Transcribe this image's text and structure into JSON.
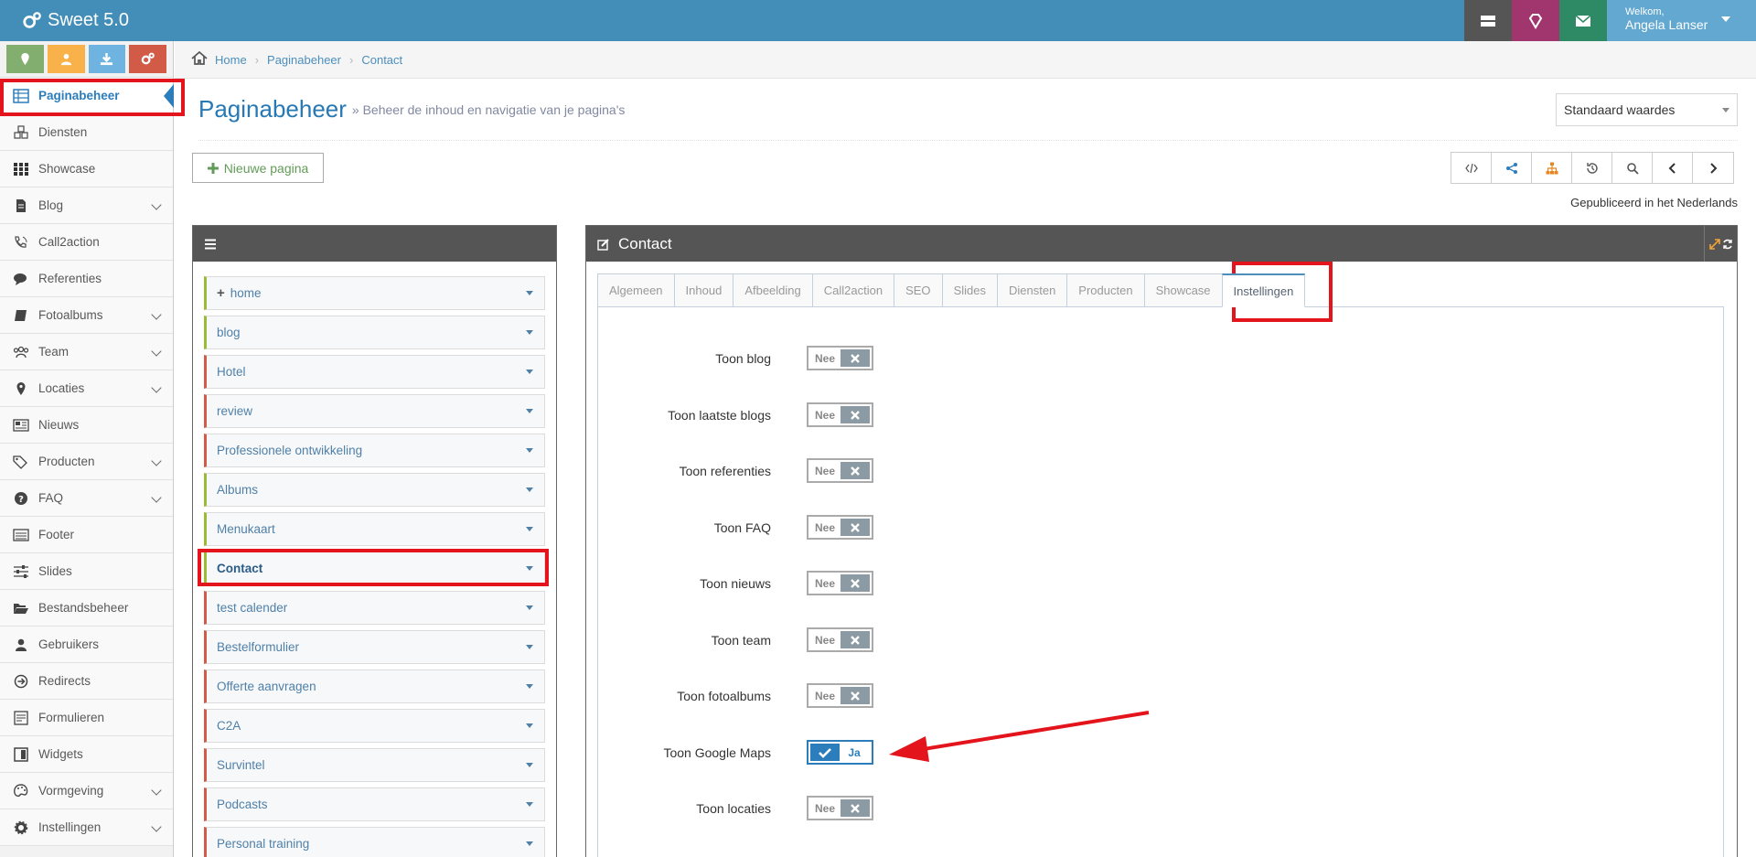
{
  "app": {
    "title": "Sweet 5.0"
  },
  "user": {
    "welcome": "Welkom,",
    "name": "Angela Lanser"
  },
  "colors": {
    "topbar": "#438eb9",
    "accent": "#2b7dbc",
    "highlight": "#e3141b"
  },
  "sidebar": {
    "shortcuts": [
      "pin-icon",
      "user-icon",
      "download-icon",
      "cogs-icon"
    ],
    "items": [
      {
        "label": "Paginabeheer",
        "icon": "table-icon"
      },
      {
        "label": "Diensten",
        "icon": "cubes-icon"
      },
      {
        "label": "Showcase",
        "icon": "grid-icon"
      },
      {
        "label": "Blog",
        "icon": "file-icon"
      },
      {
        "label": "Call2action",
        "icon": "phone-volume-icon"
      },
      {
        "label": "Referenties",
        "icon": "comments-icon"
      },
      {
        "label": "Fotoalbums",
        "icon": "book-icon"
      },
      {
        "label": "Team",
        "icon": "users-icon"
      },
      {
        "label": "Locaties",
        "icon": "map-marker-icon"
      },
      {
        "label": "Nieuws",
        "icon": "newspaper-icon"
      },
      {
        "label": "Producten",
        "icon": "tags-icon"
      },
      {
        "label": "FAQ",
        "icon": "question-icon"
      },
      {
        "label": "Footer",
        "icon": "list-alt-icon"
      },
      {
        "label": "Slides",
        "icon": "sliders-icon"
      },
      {
        "label": "Bestandsbeheer",
        "icon": "folder-open-icon"
      },
      {
        "label": "Gebruikers",
        "icon": "user-icon"
      },
      {
        "label": "Redirects",
        "icon": "arrow-circle-icon"
      },
      {
        "label": "Formulieren",
        "icon": "form-icon"
      },
      {
        "label": "Widgets",
        "icon": "widget-icon"
      },
      {
        "label": "Vormgeving",
        "icon": "palette-icon"
      },
      {
        "label": "Instellingen",
        "icon": "gear-icon"
      }
    ]
  },
  "breadcrumb": [
    "Home",
    "Paginabeheer",
    "Contact"
  ],
  "header": {
    "title": "Paginabeheer",
    "subtitle": "» Beheer de inhoud en navigatie van je pagina's"
  },
  "select": {
    "value": "Standaard waardes"
  },
  "buttons": {
    "new_page": "Nieuwe pagina"
  },
  "published": "Gepubliceerd in het Nederlands",
  "pages": [
    "home",
    "blog",
    "Hotel",
    "review",
    "Professionele ontwikkeling",
    "Albums",
    "Menukaart",
    "Contact",
    "test calender",
    "Bestelformulier",
    "Offerte aanvragen",
    "C2A",
    "Survintel",
    "Podcasts",
    "Personal training"
  ],
  "editor": {
    "title": "Contact",
    "tabs": [
      "Algemeen",
      "Inhoud",
      "Afbeelding",
      "Call2action",
      "SEO",
      "Slides",
      "Diensten",
      "Producten",
      "Showcase",
      "Instellingen"
    ],
    "yes": "Ja",
    "no": "Nee",
    "settings": [
      {
        "label": "Toon blog",
        "on": false
      },
      {
        "label": "Toon laatste blogs",
        "on": false
      },
      {
        "label": "Toon referenties",
        "on": false
      },
      {
        "label": "Toon FAQ",
        "on": false
      },
      {
        "label": "Toon nieuws",
        "on": false
      },
      {
        "label": "Toon team",
        "on": false
      },
      {
        "label": "Toon fotoalbums",
        "on": false
      },
      {
        "label": "Toon Google Maps",
        "on": true
      },
      {
        "label": "Toon locaties",
        "on": false
      }
    ]
  }
}
